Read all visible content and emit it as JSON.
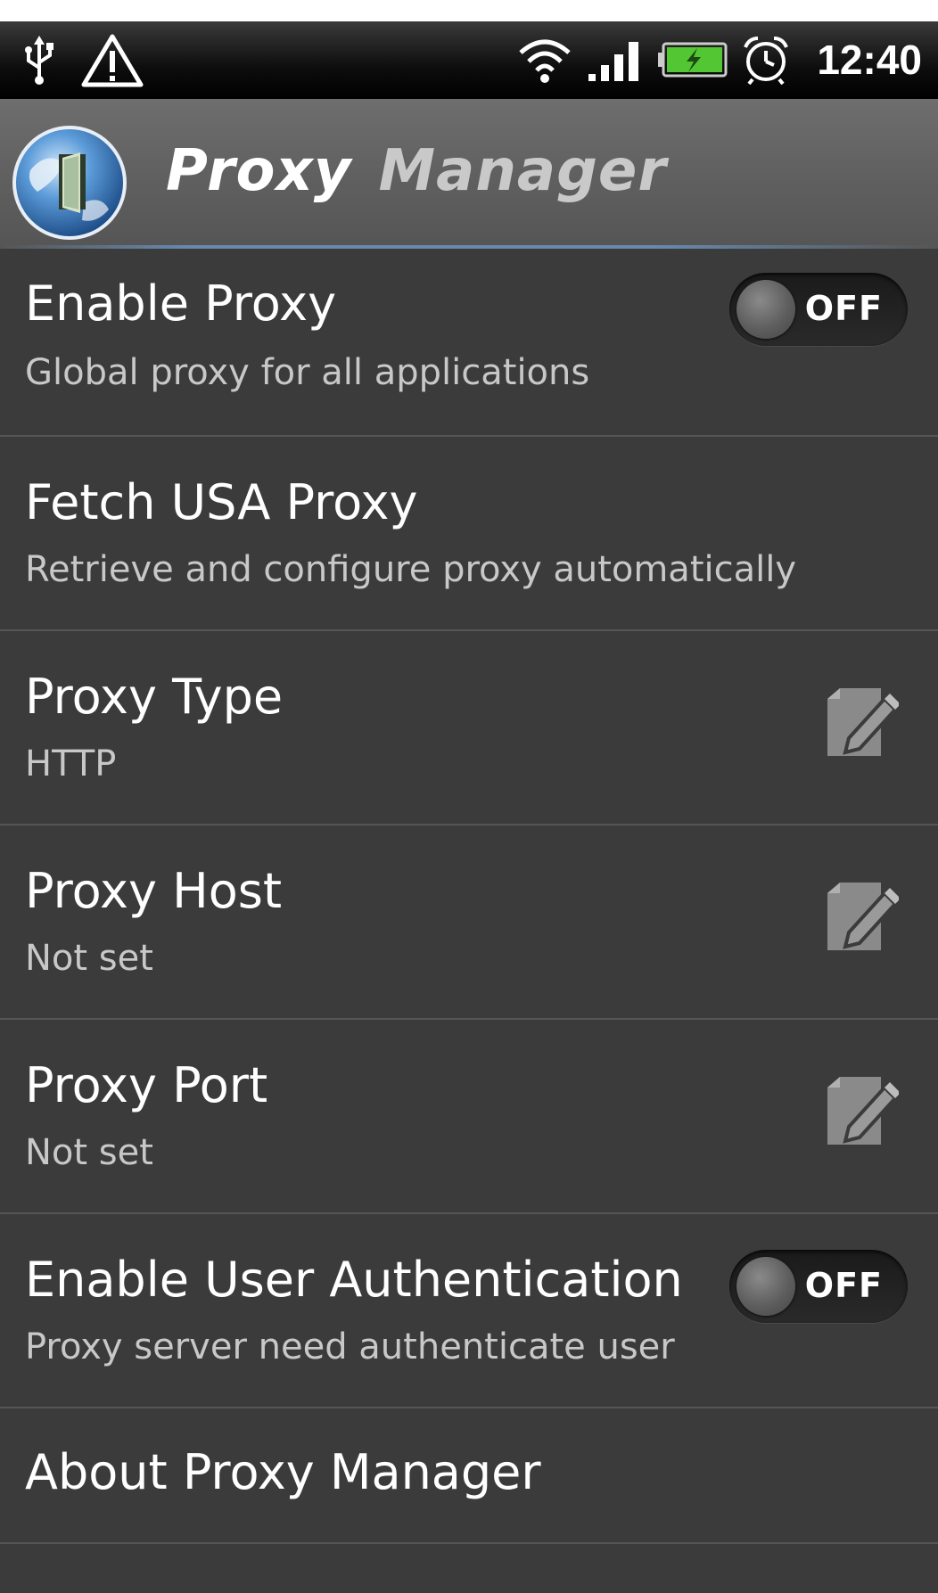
{
  "status_bar": {
    "time": "12:40",
    "icons": [
      "usb-icon",
      "warning-icon",
      "wifi-icon",
      "signal-icon",
      "battery-charging-icon",
      "alarm-icon"
    ]
  },
  "app": {
    "title_word1": "Proxy",
    "title_word2": "Manager",
    "logo": "proxy-manager-logo"
  },
  "settings": {
    "enable_proxy": {
      "title": "Enable Proxy",
      "summary": "Global proxy for all applications",
      "toggle_state": "OFF"
    },
    "fetch_usa_proxy": {
      "title": "Fetch USA Proxy",
      "summary": "Retrieve and configure proxy automatically"
    },
    "proxy_type": {
      "title": "Proxy Type",
      "summary": "HTTP",
      "icon": "edit-icon"
    },
    "proxy_host": {
      "title": "Proxy Host",
      "summary": "Not set",
      "icon": "edit-icon"
    },
    "proxy_port": {
      "title": "Proxy Port",
      "summary": "Not set",
      "icon": "edit-icon"
    },
    "enable_user_auth": {
      "title": "Enable User Authentication",
      "summary": "Proxy server need authenticate user",
      "toggle_state": "OFF"
    },
    "about": {
      "title": "About Proxy Manager"
    }
  },
  "colors": {
    "background": "#3b3b3b",
    "divider": "#555555",
    "title_text": "#ffffff",
    "summary_text": "#c8c8c8",
    "accent_underline": "#6d9fd3"
  }
}
